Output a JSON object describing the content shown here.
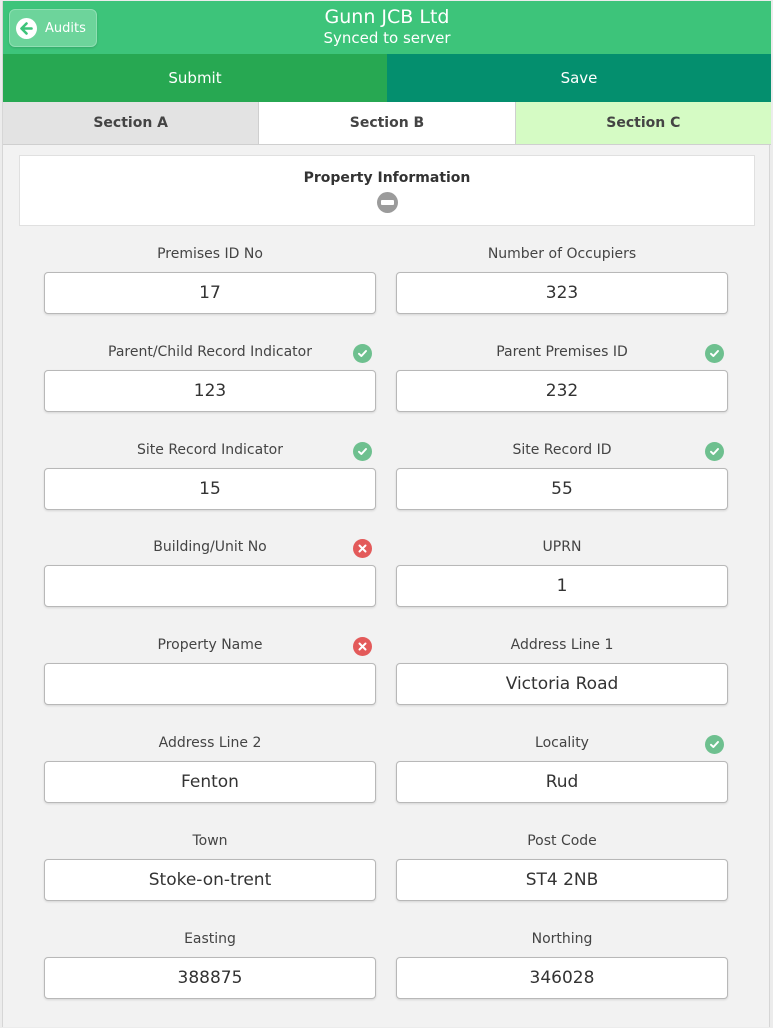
{
  "header": {
    "back_label": "Audits",
    "title": "Gunn JCB Ltd",
    "subtitle": "Synced to server"
  },
  "actions": {
    "submit_label": "Submit",
    "save_label": "Save"
  },
  "tabs": [
    {
      "label": "Section A"
    },
    {
      "label": "Section B"
    },
    {
      "label": "Section C"
    }
  ],
  "section": {
    "title": "Property Information"
  },
  "fields": [
    {
      "label": "Premises ID No",
      "value": "17",
      "status": ""
    },
    {
      "label": "Number of Occupiers",
      "value": "323",
      "status": ""
    },
    {
      "label": "Parent/Child Record Indicator",
      "value": "123",
      "status": "valid"
    },
    {
      "label": "Parent Premises ID",
      "value": "232",
      "status": "valid"
    },
    {
      "label": "Site Record Indicator",
      "value": "15",
      "status": "valid"
    },
    {
      "label": "Site Record ID",
      "value": "55",
      "status": "valid"
    },
    {
      "label": "Building/Unit No",
      "value": "",
      "status": "invalid"
    },
    {
      "label": "UPRN",
      "value": "1",
      "status": ""
    },
    {
      "label": "Property Name",
      "value": "",
      "status": "invalid"
    },
    {
      "label": "Address Line 1",
      "value": "Victoria Road",
      "status": ""
    },
    {
      "label": "Address Line 2",
      "value": "Fenton",
      "status": ""
    },
    {
      "label": "Locality",
      "value": "Rud",
      "status": "valid"
    },
    {
      "label": "Town",
      "value": "Stoke-on-trent",
      "status": ""
    },
    {
      "label": "Post Code",
      "value": "ST4 2NB",
      "status": ""
    },
    {
      "label": "Easting",
      "value": "388875",
      "status": ""
    },
    {
      "label": "Northing",
      "value": "346028",
      "status": ""
    }
  ]
}
